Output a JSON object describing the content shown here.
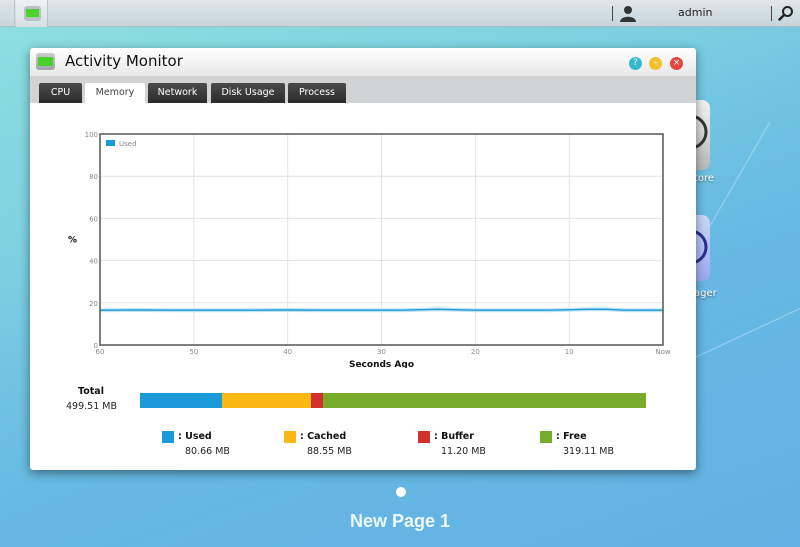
{
  "taskbar": {
    "user_name": "admin"
  },
  "desktop": {
    "icons": [
      {
        "label": "tore"
      },
      {
        "label": "ager"
      }
    ],
    "page_label": "New Page 1"
  },
  "window": {
    "title": "Activity Monitor",
    "buttons": {
      "help": "?",
      "minimize": "–",
      "close": "×"
    },
    "tabs": [
      {
        "label": "CPU",
        "active": false
      },
      {
        "label": "Memory",
        "active": true
      },
      {
        "label": "Network",
        "active": false
      },
      {
        "label": "Disk Usage",
        "active": false
      },
      {
        "label": "Process",
        "active": false
      }
    ]
  },
  "chart_data": {
    "type": "line",
    "title": "",
    "xlabel": "Seconds Ago",
    "ylabel": "%",
    "ylim": [
      0,
      100
    ],
    "xlim": [
      60,
      0
    ],
    "yticks": [
      "0",
      "20",
      "40",
      "60",
      "80",
      "100"
    ],
    "xticks": [
      "60",
      "50",
      "40",
      "30",
      "20",
      "10",
      "Now"
    ],
    "grid": true,
    "legend": {
      "position": "top-left",
      "entries": [
        "Used"
      ]
    },
    "series": [
      {
        "name": "Used",
        "color": "#1a9ad6",
        "x": [
          60,
          56,
          52,
          48,
          44,
          40,
          36,
          32,
          28,
          24,
          20,
          16,
          12,
          8,
          6,
          4,
          0
        ],
        "y": [
          16.5,
          16.6,
          16.5,
          16.5,
          16.5,
          16.6,
          16.5,
          16.5,
          16.5,
          16.9,
          16.5,
          16.5,
          16.5,
          16.9,
          16.9,
          16.5,
          16.5
        ]
      }
    ]
  },
  "memory": {
    "total_label": "Total",
    "total_value": "499.51 MB",
    "segments": [
      {
        "name": "Used",
        "label": ": Used",
        "value": "80.66 MB",
        "mb": 80.66,
        "color": "#1a9ad6"
      },
      {
        "name": "Cached",
        "label": ": Cached",
        "value": "88.55 MB",
        "mb": 88.55,
        "color": "#fbb714"
      },
      {
        "name": "Buffer",
        "label": ": Buffer",
        "value": "11.20 MB",
        "mb": 11.2,
        "color": "#d2302f"
      },
      {
        "name": "Free",
        "label": ": Free",
        "value": "319.11 MB",
        "mb": 319.11,
        "color": "#7aac2c"
      }
    ]
  }
}
